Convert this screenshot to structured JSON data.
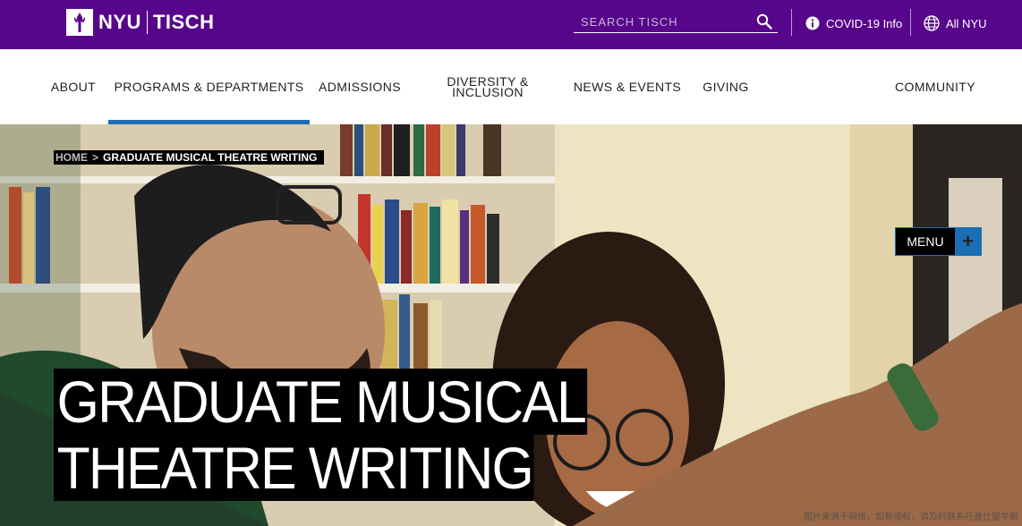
{
  "header": {
    "logo_nyu": "NYU",
    "logo_tisch": "TISCH",
    "search_placeholder": "SEARCH TISCH",
    "covid_link": "COVID-19 Info",
    "all_nyu_link": "All NYU",
    "colors": {
      "brand_purple": "#57068c",
      "accent_blue": "#1c6fb5"
    },
    "icons": [
      "nyu-torch-icon",
      "search-icon",
      "info-icon",
      "globe-icon"
    ]
  },
  "nav": {
    "items": [
      {
        "label": "ABOUT",
        "active": false
      },
      {
        "label": "PROGRAMS & DEPARTMENTS",
        "active": true
      },
      {
        "label": "ADMISSIONS",
        "active": false
      },
      {
        "label": "DIVERSITY &",
        "label2": "INCLUSION",
        "active": false
      },
      {
        "label": "NEWS & EVENTS",
        "active": false
      },
      {
        "label": "GIVING",
        "active": false
      },
      {
        "label": "COMMUNITY",
        "active": false
      }
    ]
  },
  "hero": {
    "breadcrumb": {
      "home": "HOME",
      "separator": ">",
      "current": "GRADUATE MUSICAL THEATRE WRITING"
    },
    "menu_label": "MENU",
    "menu_icon": "plus-icon",
    "title_line1": "GRADUATE MUSICAL",
    "title_line2": "THEATRE WRITING",
    "watermark": "图片来源于网络，如有侵权，请及时联系托普仕留学删"
  }
}
